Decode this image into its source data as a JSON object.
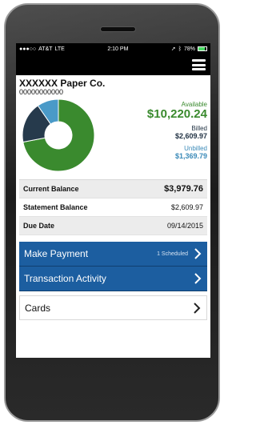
{
  "status_bar": {
    "signal": "●●●○○",
    "carrier": "AT&T",
    "network": "LTE",
    "time": "2:10 PM",
    "battery": "78%",
    "battery_level": 0.78
  },
  "account": {
    "name": "XXXXXX Paper Co.",
    "number": "00000000000"
  },
  "summary": {
    "available_label": "Available",
    "available_value": "$10,220.24",
    "billed_label": "Billed",
    "billed_value": "$2,609.97",
    "unbilled_label": "Unbilled",
    "unbilled_value": "$1,369.79"
  },
  "donut": {
    "segments": [
      {
        "name": "available",
        "value": 10220.24,
        "color": "#3a8a2e"
      },
      {
        "name": "billed",
        "value": 2609.97,
        "color": "#263a4c"
      },
      {
        "name": "unbilled",
        "value": 1369.79,
        "color": "#4a9ac8"
      }
    ]
  },
  "balances": [
    {
      "label": "Current Balance",
      "value": "$3,979.76"
    },
    {
      "label": "Statement Balance",
      "value": "$2,609.97"
    },
    {
      "label": "Due Date",
      "value": "09/14/2015"
    }
  ],
  "actions": {
    "make_payment": "Make Payment",
    "scheduled": "1 Scheduled",
    "transaction_activity": "Transaction Activity",
    "cards": "Cards"
  },
  "colors": {
    "primary_blue": "#1c5ea0",
    "available_green": "#3a8a2e",
    "billed_navy": "#263a4c",
    "unbilled_blue": "#4a9ac8"
  }
}
